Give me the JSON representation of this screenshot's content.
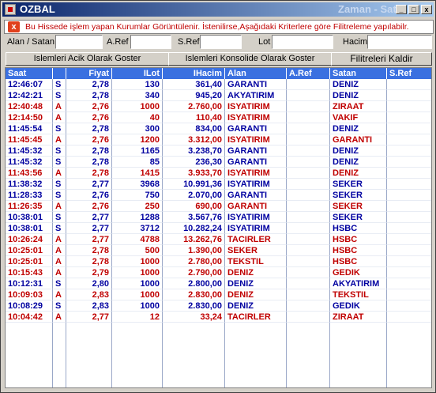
{
  "window": {
    "title": "OZBAL",
    "subtitle": "Zaman - Satis"
  },
  "titlebar_buttons": [
    "_",
    "□",
    "x"
  ],
  "info": {
    "close_glyph": "x",
    "message": "Bu Hissede işlem yapan Kurumlar Görüntülenir. İstenilirse,Aşağıdaki Kriterlere göre Filitreleme yapılabilr."
  },
  "filters": {
    "alan_satan_label": "Alan / Satan",
    "aref_label": "A.Ref",
    "sref_label": "S.Ref",
    "lot_label": "Lot",
    "hacim_label": "Hacim",
    "alan_satan_value": "",
    "aref_value": "",
    "sref_value": "",
    "lot_value": "",
    "hacim_value": ""
  },
  "buttons": {
    "acik": "Islemleri Acik Olarak Goster",
    "konsolide": "Islemleri Konsolide Olarak Goster",
    "filtre": "Filitreleri Kaldir"
  },
  "colors": {
    "sell": "#c00000",
    "buy": "#0000a0",
    "header_bg": "#3a70e0"
  },
  "table": {
    "columns": [
      "Saat",
      "",
      "Fiyat",
      "ILot",
      "IHacim",
      "Alan",
      "A.Ref",
      "Satan",
      "S.Ref"
    ],
    "rows": [
      [
        "12:46:07",
        "S",
        "2,78",
        "130",
        "361,40",
        "GARANTI",
        "",
        "DENIZ",
        ""
      ],
      [
        "12:42:21",
        "S",
        "2,78",
        "340",
        "945,20",
        "AKYATIRIM",
        "",
        "DENIZ",
        ""
      ],
      [
        "12:40:48",
        "A",
        "2,76",
        "1000",
        "2.760,00",
        "ISYATIRIM",
        "",
        "ZIRAAT",
        ""
      ],
      [
        "12:14:50",
        "A",
        "2,76",
        "40",
        "110,40",
        "ISYATIRIM",
        "",
        "VAKIF",
        ""
      ],
      [
        "11:45:54",
        "S",
        "2,78",
        "300",
        "834,00",
        "GARANTI",
        "",
        "DENIZ",
        ""
      ],
      [
        "11:45:45",
        "A",
        "2,76",
        "1200",
        "3.312,00",
        "ISYATIRIM",
        "",
        "GARANTI",
        ""
      ],
      [
        "11:45:32",
        "S",
        "2,78",
        "1165",
        "3.238,70",
        "GARANTI",
        "",
        "DENIZ",
        ""
      ],
      [
        "11:45:32",
        "S",
        "2,78",
        "85",
        "236,30",
        "GARANTI",
        "",
        "DENIZ",
        ""
      ],
      [
        "11:43:56",
        "A",
        "2,78",
        "1415",
        "3.933,70",
        "ISYATIRIM",
        "",
        "DENIZ",
        ""
      ],
      [
        "11:38:32",
        "S",
        "2,77",
        "3968",
        "10.991,36",
        "ISYATIRIM",
        "",
        "SEKER",
        ""
      ],
      [
        "11:28:33",
        "S",
        "2,76",
        "750",
        "2.070,00",
        "GARANTI",
        "",
        "SEKER",
        ""
      ],
      [
        "11:26:35",
        "A",
        "2,76",
        "250",
        "690,00",
        "GARANTI",
        "",
        "SEKER",
        ""
      ],
      [
        "10:38:01",
        "S",
        "2,77",
        "1288",
        "3.567,76",
        "ISYATIRIM",
        "",
        "SEKER",
        ""
      ],
      [
        "10:38:01",
        "S",
        "2,77",
        "3712",
        "10.282,24",
        "ISYATIRIM",
        "",
        "HSBC",
        ""
      ],
      [
        "10:26:24",
        "A",
        "2,77",
        "4788",
        "13.262,76",
        "TACIRLER",
        "",
        "HSBC",
        ""
      ],
      [
        "10:25:01",
        "A",
        "2,78",
        "500",
        "1.390,00",
        "SEKER",
        "",
        "HSBC",
        ""
      ],
      [
        "10:25:01",
        "A",
        "2,78",
        "1000",
        "2.780,00",
        "TEKSTIL",
        "",
        "HSBC",
        ""
      ],
      [
        "10:15:43",
        "A",
        "2,79",
        "1000",
        "2.790,00",
        "DENIZ",
        "",
        "GEDIK",
        ""
      ],
      [
        "10:12:31",
        "S",
        "2,80",
        "1000",
        "2.800,00",
        "DENIZ",
        "",
        "AKYATIRIM",
        ""
      ],
      [
        "10:09:03",
        "A",
        "2,83",
        "1000",
        "2.830,00",
        "DENIZ",
        "",
        "TEKSTIL",
        ""
      ],
      [
        "10:08:29",
        "S",
        "2,83",
        "1000",
        "2.830,00",
        "DENIZ",
        "",
        "GEDIK",
        ""
      ],
      [
        "10:04:42",
        "A",
        "2,77",
        "12",
        "33,24",
        "TACIRLER",
        "",
        "ZIRAAT",
        ""
      ]
    ]
  }
}
